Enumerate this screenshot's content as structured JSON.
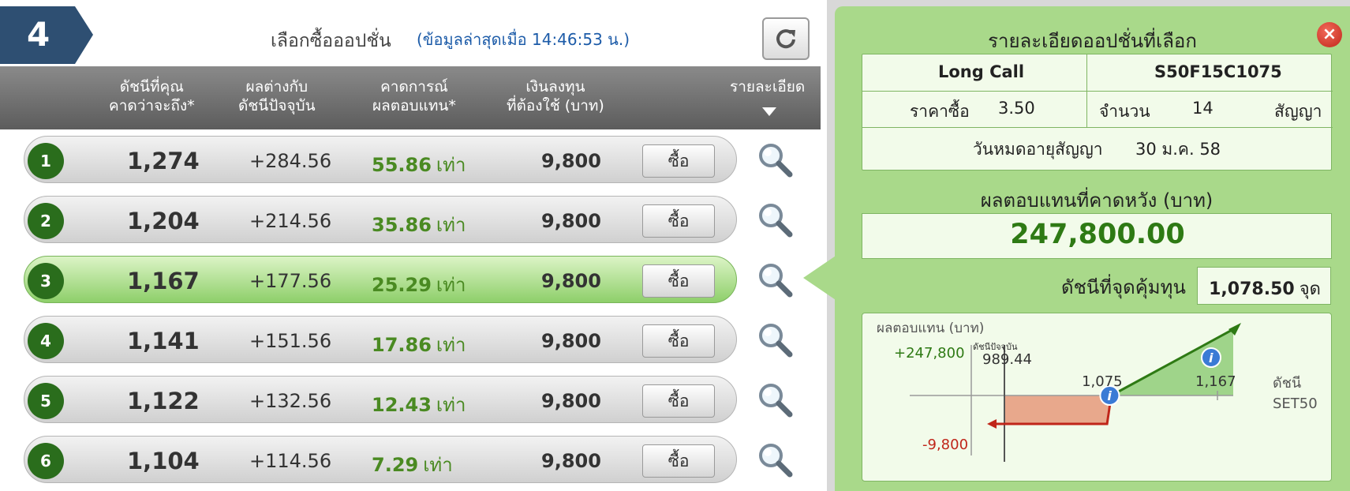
{
  "step": {
    "number": "4"
  },
  "header": {
    "title": "เลือกซื้อออปชั่น",
    "subtitle": "(ข้อมูลล่าสุดเมื่อ 14:46:53 น.)"
  },
  "columns": [
    {
      "line1": "ดัชนีที่คุณ",
      "line2": "คาดว่าจะถึง*"
    },
    {
      "line1": "ผลต่างกับ",
      "line2": "ดัชนีปัจจุบัน"
    },
    {
      "line1": "คาดการณ์",
      "line2": "ผลตอบแทน*"
    },
    {
      "line1": "เงินลงทุน",
      "line2": "ที่ต้องใช้ (บาท)"
    },
    {
      "line1": "รายละเอียด",
      "line2": ""
    }
  ],
  "rows": [
    {
      "num": "1",
      "index": "1,274",
      "diff": "+284.56",
      "ret": "55.86",
      "ret_unit": "เท่า",
      "invest": "9,800",
      "buy": "ซื้อ"
    },
    {
      "num": "2",
      "index": "1,204",
      "diff": "+214.56",
      "ret": "35.86",
      "ret_unit": "เท่า",
      "invest": "9,800",
      "buy": "ซื้อ"
    },
    {
      "num": "3",
      "index": "1,167",
      "diff": "+177.56",
      "ret": "25.29",
      "ret_unit": "เท่า",
      "invest": "9,800",
      "buy": "ซื้อ"
    },
    {
      "num": "4",
      "index": "1,141",
      "diff": "+151.56",
      "ret": "17.86",
      "ret_unit": "เท่า",
      "invest": "9,800",
      "buy": "ซื้อ"
    },
    {
      "num": "5",
      "index": "1,122",
      "diff": "+132.56",
      "ret": "12.43",
      "ret_unit": "เท่า",
      "invest": "9,800",
      "buy": "ซื้อ"
    },
    {
      "num": "6",
      "index": "1,104",
      "diff": "+114.56",
      "ret": "7.29",
      "ret_unit": "เท่า",
      "invest": "9,800",
      "buy": "ซื้อ"
    }
  ],
  "selected_row": 3,
  "detail": {
    "title": "รายละเอียดออปชั่นที่เลือก",
    "strategy": "Long Call",
    "series": "S50F15C1075",
    "price_label": "ราคาซื้อ",
    "price": "3.50",
    "qty_label": "จำนวน",
    "qty": "14",
    "qty_unit": "สัญญา",
    "expiry_label": "วันหมดอายุสัญญา",
    "expiry": "30 ม.ค. 58",
    "expected_label": "ผลตอบแทนที่คาดหวัง (บาท)",
    "expected_value": "247,800.00",
    "breakeven_label": "ดัชนีที่จุดคุ้มทุน",
    "breakeven_value": "1,078.50",
    "breakeven_unit": "จุด"
  },
  "chart_data": {
    "type": "line",
    "title": "",
    "ylabel": "ผลตอบแทน (บาท)",
    "xlabel_line1": "ดัชนี",
    "xlabel_line2": "SET50",
    "current_label": "ดัชนีปัจจุบัน",
    "current_value": "989.44",
    "y_max_label": "+247,800",
    "y_min_label": "-9,800",
    "strike_label": "1,075",
    "target_label": "1,167",
    "x": [
      989.44,
      1075,
      1078.5,
      1167
    ],
    "y": [
      -9800,
      -9800,
      0,
      247800
    ],
    "colors": {
      "loss": "#c0261a",
      "profit": "#2e7a14",
      "loss_fill": "#e8a88c",
      "profit_fill": "#9fd48a"
    }
  },
  "colors": {
    "accent": "#2a6d1c",
    "badge": "#2e4f72",
    "panel": "#a9d98a"
  }
}
